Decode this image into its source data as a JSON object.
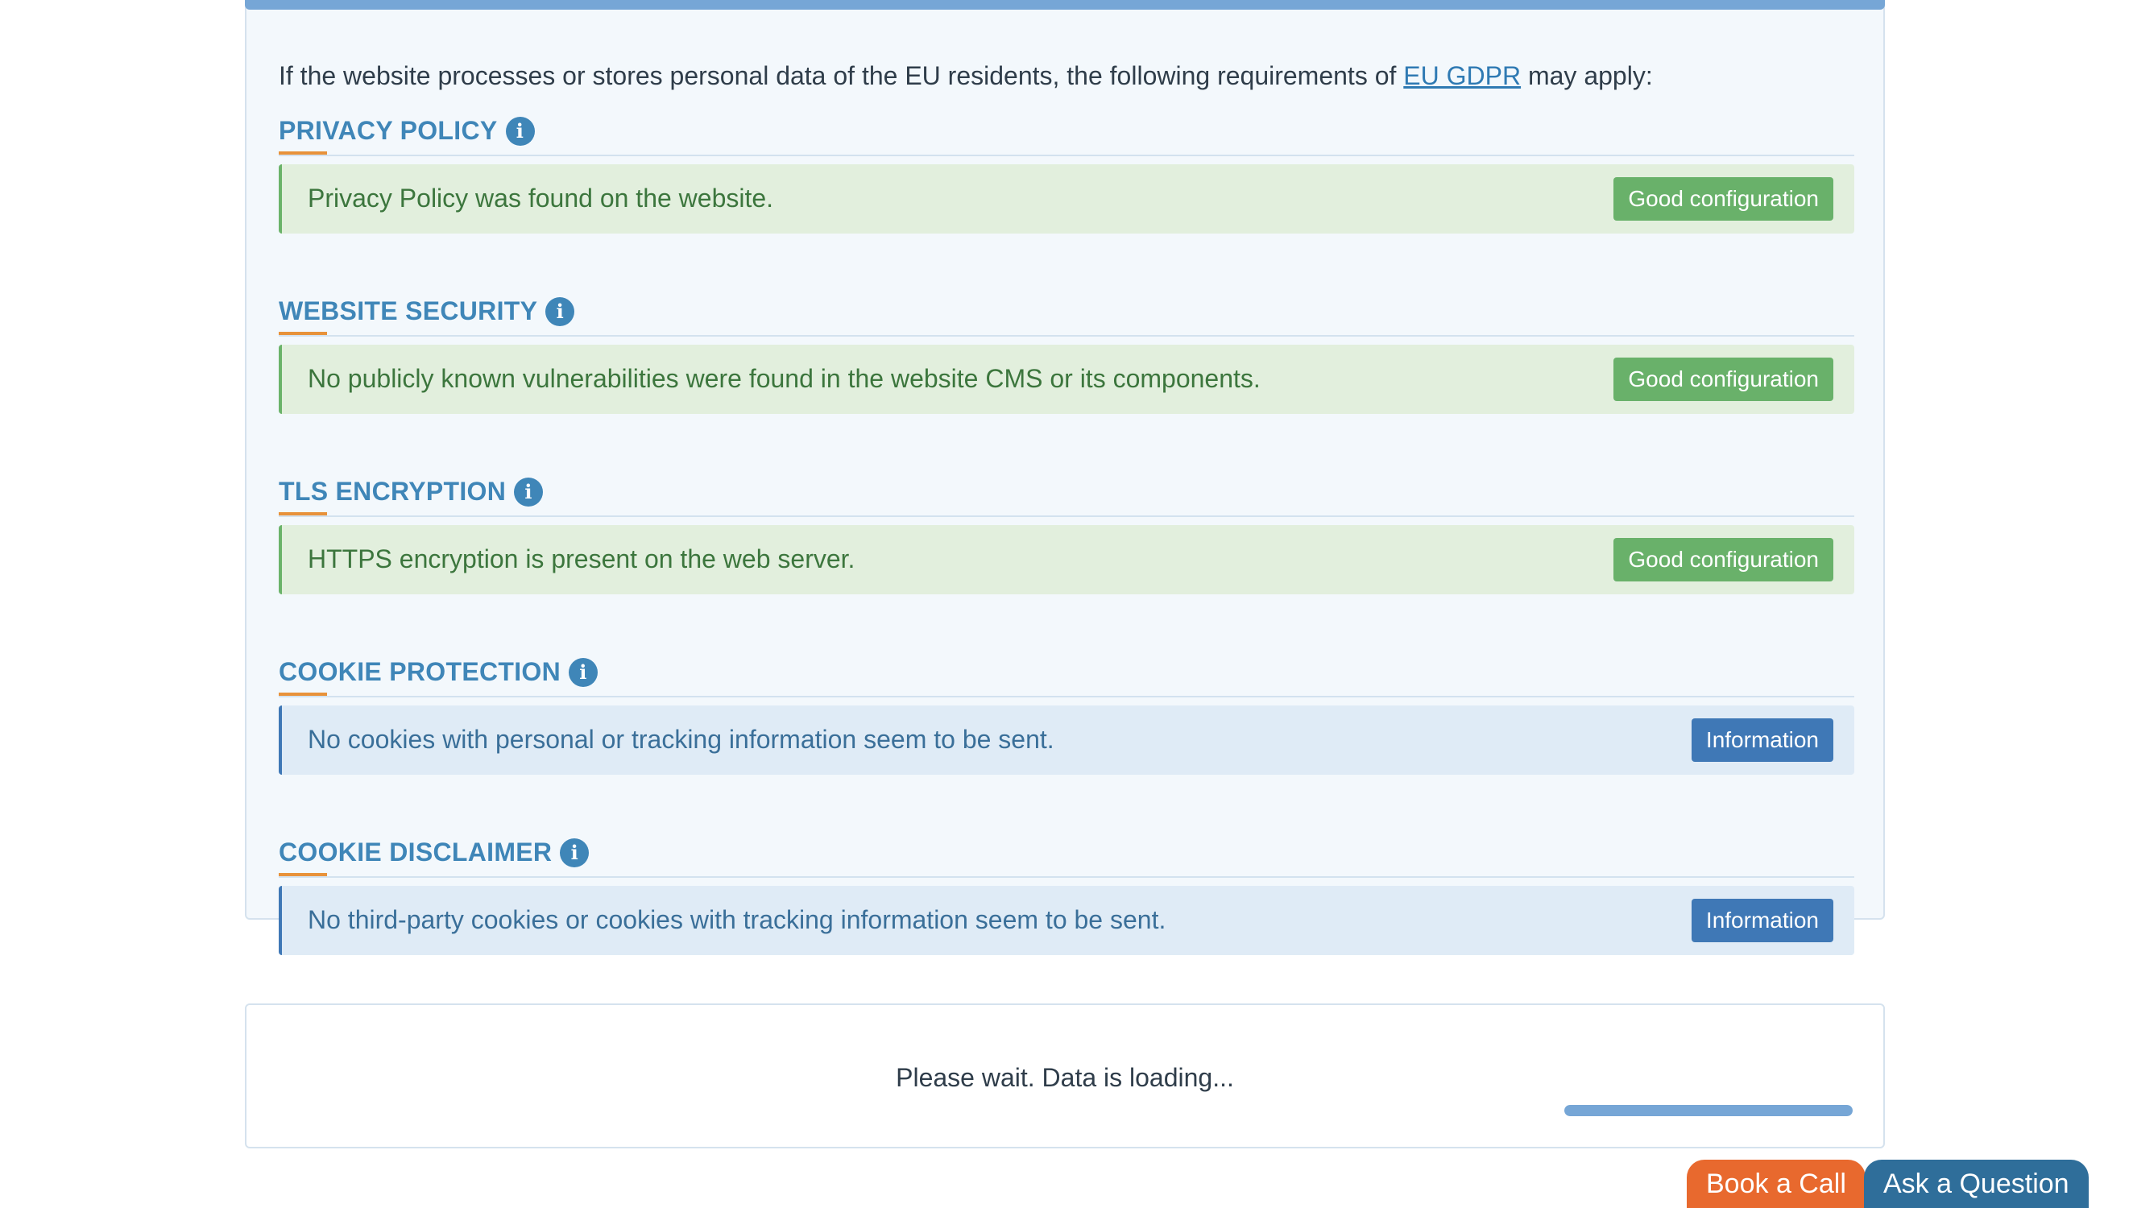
{
  "intro": {
    "before": "If the website processes or stores personal data of the EU residents, the following requirements of ",
    "link": "EU GDPR",
    "after": " may apply:"
  },
  "sections": [
    {
      "title": "PRIVACY POLICY",
      "info_icon": "i",
      "result": "Privacy Policy was found on the website.",
      "badge": "Good configuration",
      "status": "good"
    },
    {
      "title": "WEBSITE SECURITY",
      "info_icon": "i",
      "result": "No publicly known vulnerabilities were found in the website CMS or its components.",
      "badge": "Good configuration",
      "status": "good"
    },
    {
      "title": "TLS ENCRYPTION",
      "info_icon": "i",
      "result": "HTTPS encryption is present on the web server.",
      "badge": "Good configuration",
      "status": "good"
    },
    {
      "title": "COOKIE PROTECTION",
      "info_icon": "i",
      "result": "No cookies with personal or tracking information seem to be sent.",
      "badge": "Information",
      "status": "info"
    },
    {
      "title": "COOKIE DISCLAIMER",
      "info_icon": "i",
      "result": "No third-party cookies or cookies with tracking information seem to be sent.",
      "badge": "Information",
      "status": "info"
    }
  ],
  "loading": {
    "text": "Please wait. Data is loading...",
    "progress_percent": 100
  },
  "cta": {
    "book_call": "Book a Call",
    "ask_question": "Ask a Question"
  },
  "colors": {
    "good": "#69b16a",
    "info": "#3f78b6",
    "accent": "#e8923a",
    "heading": "#3f86b8"
  }
}
